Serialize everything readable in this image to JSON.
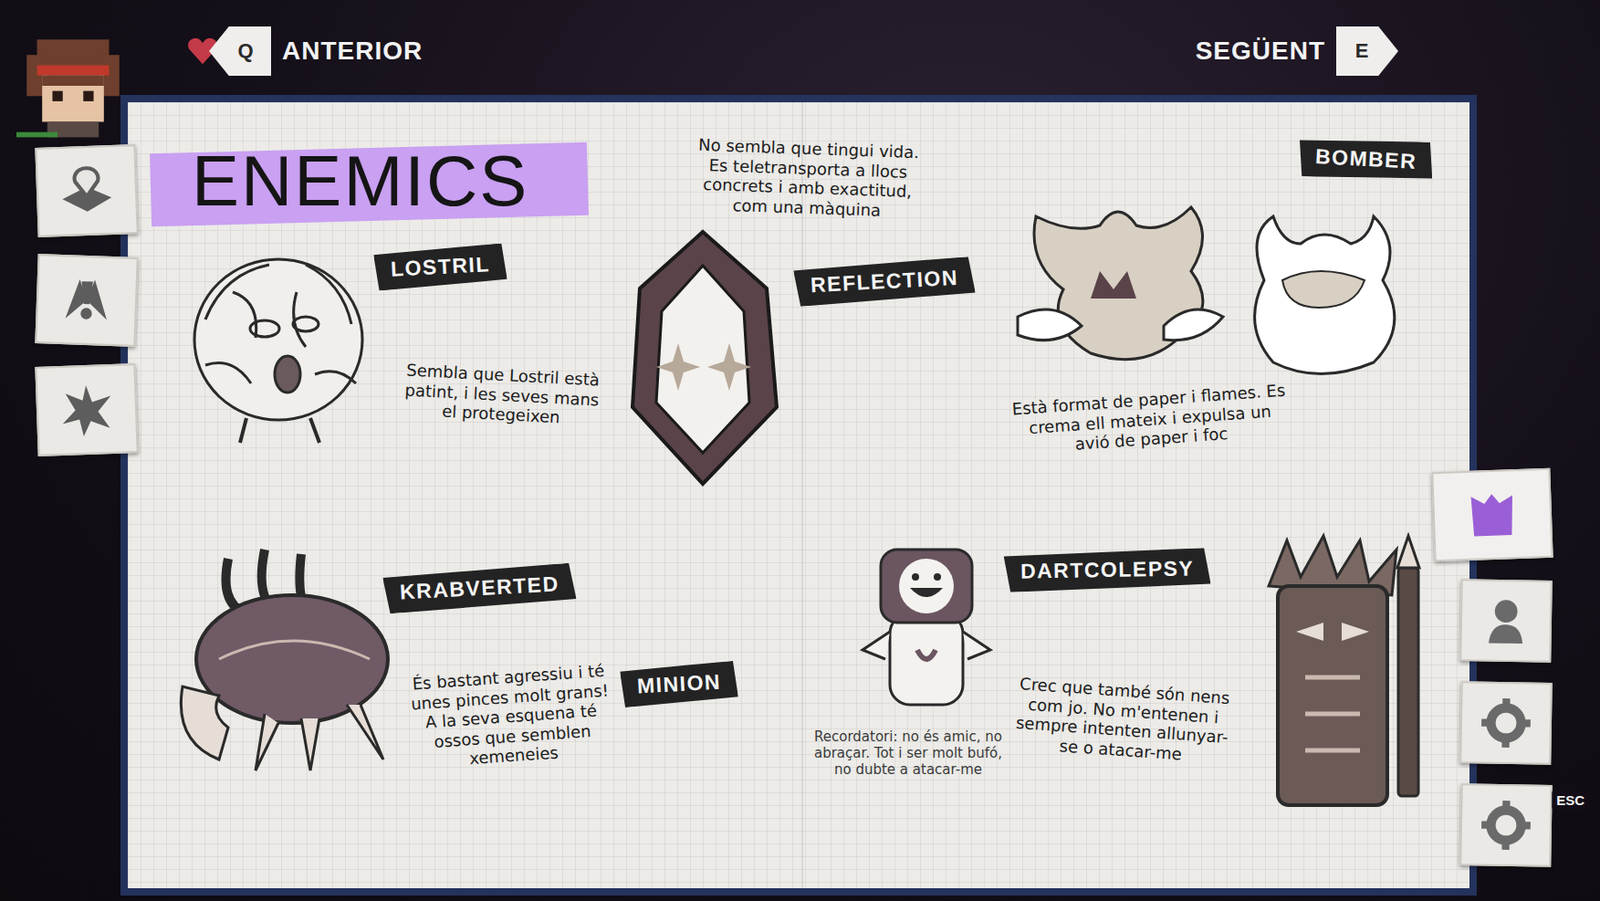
{
  "nav": {
    "previous": {
      "key": "Q",
      "label": "ANTERIOR"
    },
    "next": {
      "key": "E",
      "label": "SEGÜENT"
    }
  },
  "left_tabs": [
    {
      "selected": false
    },
    {
      "selected": false
    },
    {
      "selected": false
    }
  ],
  "right_tabs": [
    {
      "selected": true
    },
    {
      "selected": false
    },
    {
      "selected": false
    },
    {
      "selected": false
    }
  ],
  "page": {
    "title": "ENEMICS",
    "enemies": [
      {
        "name": "LOSTRIL",
        "kind": "journal",
        "description": "Sembla que Lostril està patint, i les seves mans el protegeixen"
      },
      {
        "name": "REFLECTION",
        "kind": "journal",
        "description": "No sembla que tingui vida. Es teletransporta a llocs concrets i amb exactitud, com una màquina"
      },
      {
        "name": "BOMBER",
        "kind": "journal",
        "description": "Està format de paper i flames. Es crema ell mateix i expulsa un avió de paper i foc"
      },
      {
        "name": "KRABVERTED",
        "kind": "journal",
        "description": "És bastant agressiu i té unes pinces molt grans! A la seva esquena té ossos que semblen xemeneies"
      },
      {
        "name": "MINION",
        "kind": "reminder",
        "description": "Recordatori: no és amic, no abraçar. Tot i ser molt bufó, no dubte a atacar-me"
      },
      {
        "name": "DARTCOLEPSY",
        "kind": "journal",
        "description": "Crec que també són nens com jo. No m'entenen i sempre intenten allunyar-se o atacar-me"
      }
    ]
  },
  "close_hint": "ESC"
}
